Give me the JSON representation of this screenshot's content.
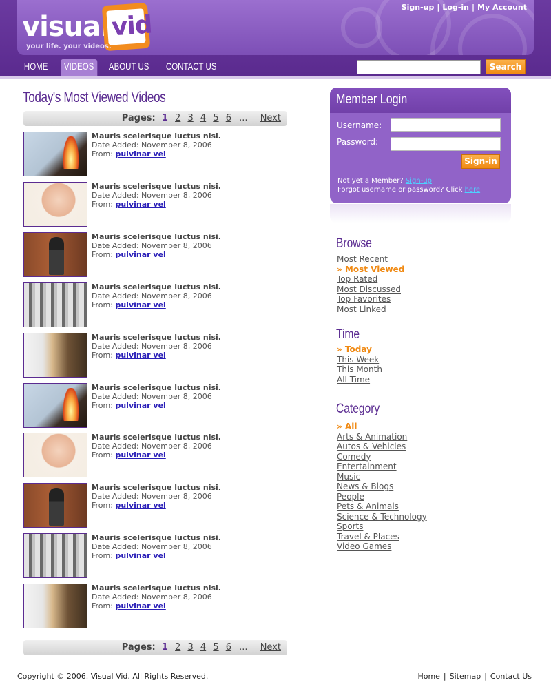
{
  "header": {
    "logo_word1": "visual",
    "logo_word2": "vid",
    "tagline": "your life. your videos.",
    "top_links": [
      "Sign-up",
      "Log-in",
      "My Account"
    ],
    "nav": [
      "HOME",
      "VIDEOS",
      "ABOUT US",
      "CONTACT US"
    ],
    "active_nav": "VIDEOS",
    "search_value": "",
    "search_button": "Search"
  },
  "main": {
    "title": "Today's Most Viewed Videos",
    "pager": {
      "label": "Pages:",
      "pages": [
        "1",
        "2",
        "3",
        "4",
        "5",
        "6"
      ],
      "current": "1",
      "ellipsis": "...",
      "next": "Next"
    },
    "videos": [
      {
        "title": "Mauris scelerisque luctus nisi.",
        "date": "Date Added: November 8, 2006",
        "from_label": "From:",
        "from_user": "pulvinar vel",
        "thumb": "fire"
      },
      {
        "title": "Mauris scelerisque luctus nisi.",
        "date": "Date Added: November 8, 2006",
        "from_label": "From:",
        "from_user": "pulvinar vel",
        "thumb": "face"
      },
      {
        "title": "Mauris scelerisque luctus nisi.",
        "date": "Date Added: November 8, 2006",
        "from_label": "From:",
        "from_user": "pulvinar vel",
        "thumb": "costume"
      },
      {
        "title": "Mauris scelerisque luctus nisi.",
        "date": "Date Added: November 8, 2006",
        "from_label": "From:",
        "from_user": "pulvinar vel",
        "thumb": "crowd"
      },
      {
        "title": "Mauris scelerisque luctus nisi.",
        "date": "Date Added: November 8, 2006",
        "from_label": "From:",
        "from_user": "pulvinar vel",
        "thumb": "owl"
      },
      {
        "title": "Mauris scelerisque luctus nisi.",
        "date": "Date Added: November 8, 2006",
        "from_label": "From:",
        "from_user": "pulvinar vel",
        "thumb": "fire"
      },
      {
        "title": "Mauris scelerisque luctus nisi.",
        "date": "Date Added: November 8, 2006",
        "from_label": "From:",
        "from_user": "pulvinar vel",
        "thumb": "face"
      },
      {
        "title": "Mauris scelerisque luctus nisi.",
        "date": "Date Added: November 8, 2006",
        "from_label": "From:",
        "from_user": "pulvinar vel",
        "thumb": "costume"
      },
      {
        "title": "Mauris scelerisque luctus nisi.",
        "date": "Date Added: November 8, 2006",
        "from_label": "From:",
        "from_user": "pulvinar vel",
        "thumb": "crowd"
      },
      {
        "title": "Mauris scelerisque luctus nisi.",
        "date": "Date Added: November 8, 2006",
        "from_label": "From:",
        "from_user": "pulvinar vel",
        "thumb": "owl"
      }
    ]
  },
  "login": {
    "title": "Member Login",
    "username_label": "Username:",
    "password_label": "Password:",
    "username_value": "",
    "password_value": "",
    "signin_button": "Sign-in",
    "not_member": "Not yet a Member?",
    "signup_link": "Sign-up",
    "forgot_text": "Forgot username or password? Click",
    "forgot_link": "here"
  },
  "sidebar": {
    "browse": {
      "title": "Browse",
      "items": [
        "Most Recent",
        "» Most Viewed",
        "Top Rated",
        "Most Discussed",
        "Top Favorites",
        "Most Linked"
      ],
      "active_index": 1
    },
    "time": {
      "title": "Time",
      "items": [
        "» Today",
        "This Week",
        "This Month",
        "All Time"
      ],
      "active_index": 0
    },
    "category": {
      "title": "Category",
      "items": [
        "» All",
        "Arts & Animation",
        "Autos & Vehicles",
        "Comedy",
        "Entertainment",
        "Music",
        "News & Blogs",
        "People",
        "Pets & Animals",
        "Science & Technology",
        "Sports",
        "Travel & Places",
        "Video Games"
      ],
      "active_index": 0
    }
  },
  "footer": {
    "copyright": "Copyright © 2006. Visual Vid. All Rights Reserved.",
    "links": [
      "Home",
      "Sitemap",
      "Contact Us"
    ]
  },
  "colors": {
    "brand_purple": "#5b2c91",
    "accent_orange": "#f08a14",
    "link_blue": "#2a1fb8"
  }
}
